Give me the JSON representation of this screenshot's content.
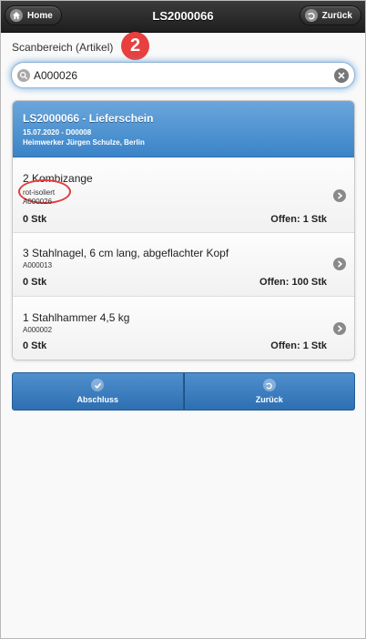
{
  "header": {
    "home_label": "Home",
    "title": "LS2000066",
    "back_label": "Zurück"
  },
  "scan": {
    "label": "Scanbereich (Artikel)",
    "marker": "2",
    "value": "A000026"
  },
  "delivery": {
    "title": "LS2000066 - Lieferschein",
    "date_line": "15.07.2020 - D00008",
    "customer_line": "Heimwerker Jürgen Schulze, Berlin"
  },
  "items": [
    {
      "title": "2 Kombizange",
      "variant": "rot-isoliert",
      "article": "A000026",
      "qty": "0 Stk",
      "open": "Offen: 1 Stk"
    },
    {
      "title": "3 Stahlnagel, 6 cm lang, abgeflachter Kopf",
      "article": "A000013",
      "qty": "0 Stk",
      "open": "Offen: 100 Stk"
    },
    {
      "title": "1 Stahlhammer 4,5 kg",
      "article": "A000002",
      "qty": "0 Stk",
      "open": "Offen: 1 Stk"
    }
  ],
  "footer": {
    "finish_label": "Abschluss",
    "back_label": "Zurück"
  },
  "colors": {
    "accent": "#3b84c8",
    "marker": "#e83f3f"
  },
  "icons": {
    "home": "home-icon",
    "back": "undo-icon",
    "search": "search-icon",
    "clear": "clear-icon",
    "arrow": "chevron-right-icon",
    "check": "check-icon"
  }
}
